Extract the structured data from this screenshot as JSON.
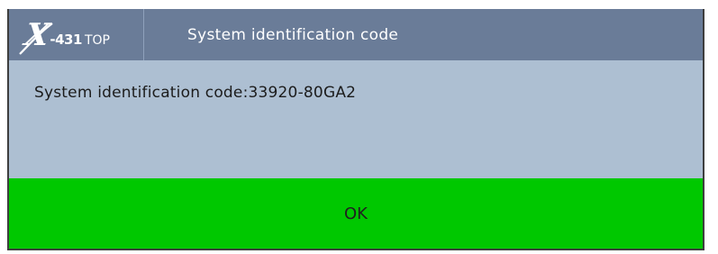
{
  "logo": {
    "x": "X",
    "model": "-431",
    "edition": "TOP"
  },
  "dialog": {
    "title": "System identification code",
    "message": "System identification code:33920-80GA2",
    "ok_label": "OK"
  },
  "colors": {
    "titlebar": "#6a7c98",
    "body": "#adbfd2",
    "ok_button": "#00c800"
  }
}
